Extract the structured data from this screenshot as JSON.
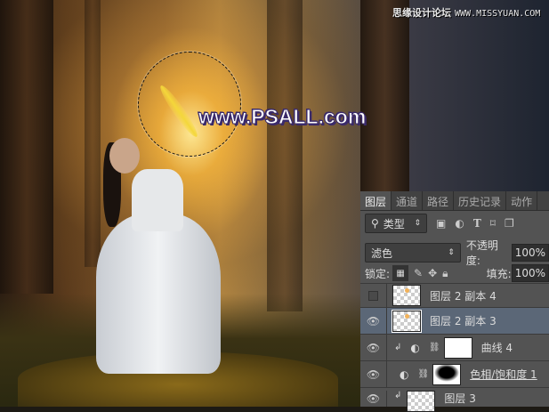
{
  "watermark": {
    "text": "www.PSALL.com",
    "site_cn": "思缘设计论坛",
    "site_url": "WWW.MISSYUAN.COM"
  },
  "panel": {
    "tabs": [
      {
        "label": "图层",
        "active": true
      },
      {
        "label": "通道"
      },
      {
        "label": "路径"
      },
      {
        "label": "历史记录"
      },
      {
        "label": "动作"
      }
    ],
    "filter": {
      "label": "类型",
      "icons": [
        "image-filter-icon",
        "adjustment-filter-icon",
        "type-filter-icon",
        "shape-filter-icon",
        "smart-object-filter-icon"
      ]
    },
    "blend_mode": "滤色",
    "opacity_label": "不透明度:",
    "opacity": "100%",
    "lock_label": "锁定:",
    "fill_label": "填充:",
    "fill": "100%",
    "layers": [
      {
        "name": "图层 2 副本 4",
        "visible": false
      },
      {
        "name": "图层 2 副本 3",
        "visible": true,
        "selected": true
      },
      {
        "name": "曲线 4",
        "visible": true,
        "type": "curves",
        "clipped": true
      },
      {
        "name": "色相/饱和度 1",
        "visible": true,
        "type": "hue-saturation"
      },
      {
        "name": "图层 3",
        "visible": true,
        "clipped": true
      }
    ]
  }
}
